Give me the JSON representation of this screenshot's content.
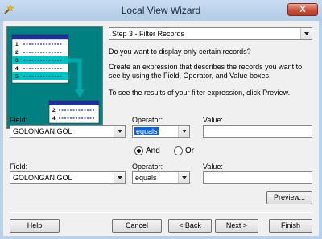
{
  "window": {
    "title": "Local View Wizard",
    "close_glyph": "X",
    "icon": "wizard-icon"
  },
  "illustration": {
    "left_rows": [
      "1",
      "2",
      "3",
      "4",
      "5"
    ],
    "right_rows": [
      "2",
      "4"
    ]
  },
  "step": {
    "selected": "Step 3 - Filter Records"
  },
  "instructions": {
    "line1": "Do you want to display only certain records?",
    "line2": "Create an expression that describes the records you want to see by using the Field, Operator, and Value boxes.",
    "line3": "To see the results of your filter expression, click Preview."
  },
  "row1": {
    "field_label": "Field:",
    "field_value": "GOLONGAN.GOL",
    "operator_label": "Operator:",
    "operator_value": "equals",
    "value_label": "Value:",
    "value_value": ""
  },
  "logic": {
    "and_label": "And",
    "or_label": "Or",
    "selected": "And"
  },
  "row2": {
    "field_label": "Field:",
    "field_value": "GOLONGAN.GOL",
    "operator_label": "Operator:",
    "operator_value": "equals",
    "value_label": "Value:",
    "value_value": ""
  },
  "buttons": {
    "preview": "Preview...",
    "help": "Help",
    "cancel": "Cancel",
    "back": "< Back",
    "next": "Next >",
    "finish": "Finish"
  },
  "colors": {
    "illustration_bg": "#008080",
    "table_header": "#1f2e9e",
    "highlight": "#00c0c0"
  }
}
